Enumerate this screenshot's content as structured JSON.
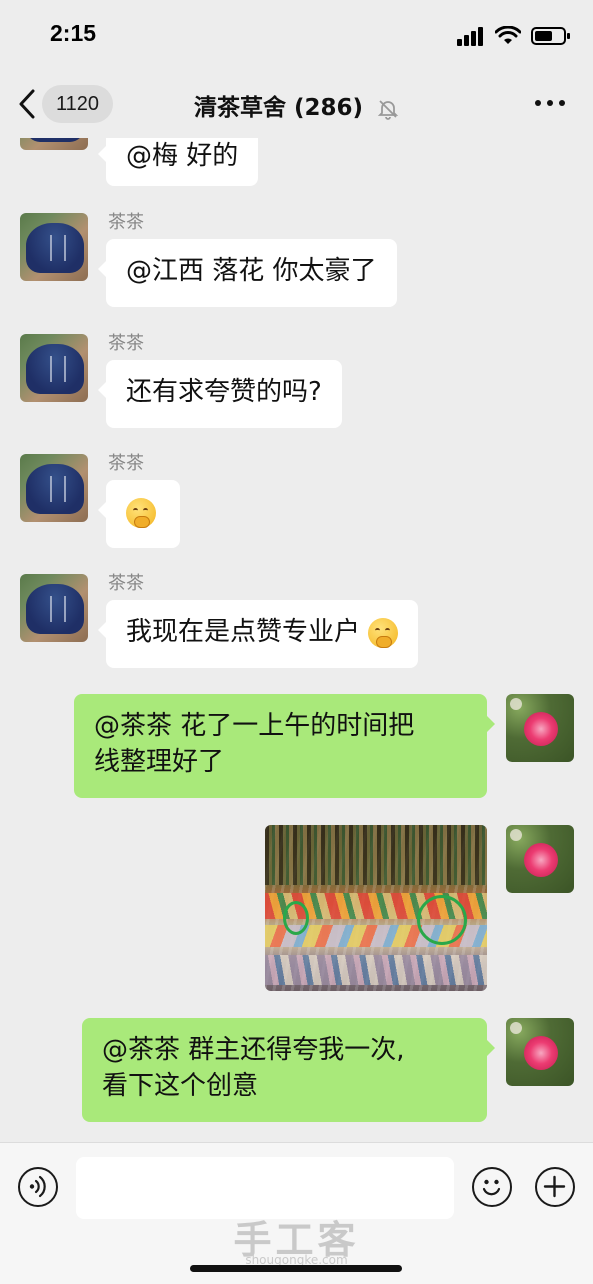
{
  "status_bar": {
    "time": "2:15",
    "icons": [
      "signal-icon",
      "wifi-icon",
      "battery-icon"
    ]
  },
  "nav": {
    "back_count": "1120",
    "title": "清茶草舍 (286)",
    "mute_icon": "bell-muted-icon",
    "more_icon": "more-dots-icon"
  },
  "messages": [
    {
      "direction": "in",
      "sender": "",
      "text": "@梅 好的",
      "avatar": "pouch"
    },
    {
      "direction": "in",
      "sender": "茶茶",
      "text": "@江西 落花 你太豪了",
      "avatar": "pouch"
    },
    {
      "direction": "in",
      "sender": "茶茶",
      "text": "还有求夸赞的吗?",
      "avatar": "pouch"
    },
    {
      "direction": "in",
      "sender": "茶茶",
      "text": "",
      "emoji": "thinking-face-emoji",
      "avatar": "pouch"
    },
    {
      "direction": "in",
      "sender": "茶茶",
      "text": "我现在是点赞专业户",
      "emoji": "thinking-face-emoji",
      "avatar": "pouch"
    },
    {
      "direction": "out",
      "text_line1": "@茶茶 花了一上午的时间把",
      "text_line2": "线整理好了",
      "avatar": "flower"
    },
    {
      "direction": "out",
      "type": "image",
      "image": "braided-threads-photo",
      "avatar": "flower"
    },
    {
      "direction": "out",
      "text_line1": "@茶茶 群主还得夸我一次,",
      "text_line2": "看下这个创意",
      "avatar": "flower"
    }
  ],
  "input_bar": {
    "voice_icon": "voice-icon",
    "emoji_icon": "emoji-icon",
    "plus_icon": "plus-icon",
    "watermark": "手工客",
    "watermark_sub": "shougongke.com"
  },
  "colors": {
    "background": "#ededed",
    "incoming_bubble": "#ffffff",
    "outgoing_bubble": "#a9e97a"
  }
}
